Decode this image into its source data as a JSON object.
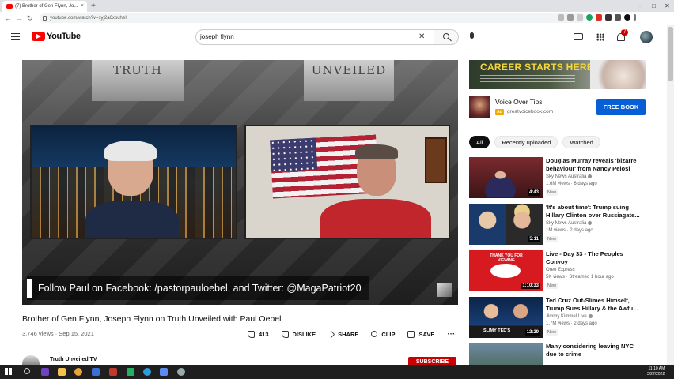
{
  "browser": {
    "tab_title": "(7) Brother of Gen Flynn, Jo...",
    "tab_close": "×",
    "new_tab": "+",
    "url": "youtube.com/watch?v=syj2a6xpuheI",
    "window_controls": [
      "‒",
      "□",
      "✕"
    ]
  },
  "header": {
    "logo_text": "YouTube",
    "search_query": "joseph flynn",
    "clear_symbol": "✕",
    "notification_count": "7"
  },
  "video": {
    "banner_left": "TRUTH",
    "banner_right": "UNVEILED",
    "lower_third": "Follow Paul on Facebook: /pastorpauloebel, and Twitter: @MagaPatriot20",
    "title": "Brother of Gen Flynn, Joseph Flynn on Truth Unveiled with Paul Oebel",
    "views_date": "3,746 views · Sep 15, 2021",
    "actions": {
      "likes": "413",
      "dislike": "DISLIKE",
      "share": "SHARE",
      "clip": "CLIP",
      "save": "SAVE",
      "more": "···"
    },
    "channel_name": "Truth Unveiled TV",
    "subscribe": "SUBSCRIBE"
  },
  "ad": {
    "banner_headline": "CAREER STARTS HERE!",
    "title": "Voice Over Tips",
    "badge": "Ad",
    "domain": "greatvoicebook.com",
    "cta": "FREE BOOK"
  },
  "chips": [
    "All",
    "Recently uploaded",
    "Watched"
  ],
  "recommendations": [
    {
      "title": "Douglas Murray reveals 'bizarre behaviour' from Nancy Pelosi",
      "channel": "Sky News Australia",
      "stats": "1.6M views · 6 days ago",
      "badge": "New",
      "duration": "4:43"
    },
    {
      "title": "'It's about time': Trump suing Hillary Clinton over Russiagate...",
      "channel": "Sky News Australia",
      "stats": "1M views · 2 days ago",
      "badge": "New",
      "duration": "5:11"
    },
    {
      "title": "Live - Day 33 - The Peoples Convoy",
      "channel": "Oreo Express",
      "stats": "5K views · Streamed 1 hour ago",
      "badge": "New",
      "duration": "1:10:33"
    },
    {
      "title": "Ted Cruz Out-Slimes Himself, Trump Sues Hillary & the Awfu...",
      "channel": "Jimmy Kimmel Live",
      "stats": "1.7M views · 2 days ago",
      "badge": "New",
      "duration": "12:29"
    },
    {
      "title": "Many considering leaving NYC due to crime",
      "channel": "",
      "stats": "",
      "badge": "",
      "duration": ""
    }
  ],
  "taskbar": {
    "time": "11:10 AM",
    "date": "3/27/2022"
  }
}
